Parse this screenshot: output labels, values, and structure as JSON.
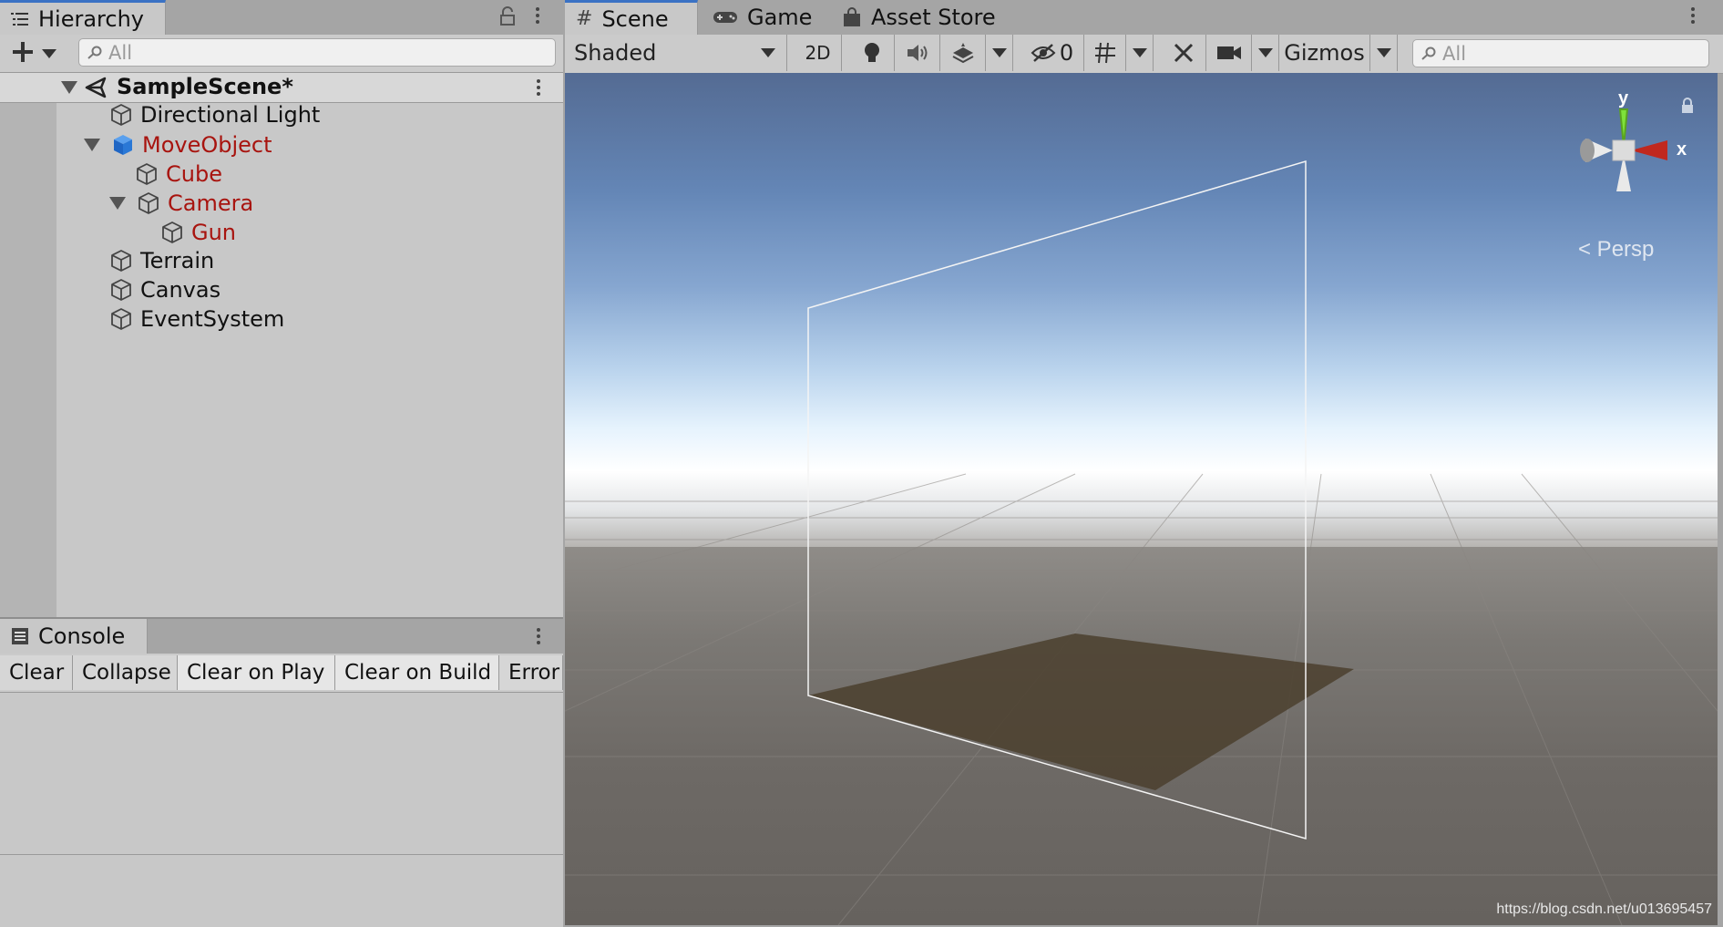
{
  "hierarchy": {
    "tab_label": "Hierarchy",
    "search_placeholder": "All",
    "scene_name": "SampleScene*",
    "items": [
      {
        "label": "Directional Light"
      },
      {
        "label": "MoveObject"
      },
      {
        "label": "Cube"
      },
      {
        "label": "Camera"
      },
      {
        "label": "Gun"
      },
      {
        "label": "Terrain"
      },
      {
        "label": "Canvas"
      },
      {
        "label": "EventSystem"
      }
    ]
  },
  "console": {
    "tab_label": "Console",
    "buttons": {
      "clear": "Clear",
      "collapse": "Collapse",
      "clear_on_play": "Clear on Play",
      "clear_on_build": "Clear on Build",
      "error_pause": "Error Pause"
    }
  },
  "scene_window": {
    "tabs": {
      "scene": "Scene",
      "game": "Game",
      "asset_store": "Asset Store"
    },
    "toolbar": {
      "shading_mode": "Shaded",
      "mode_2d": "2D",
      "hidden_count": "0",
      "gizmos": "Gizmos",
      "search_placeholder": "All"
    },
    "gizmo": {
      "y_label": "y",
      "x_label": "x",
      "projection": "< Persp"
    },
    "watermark": "https://blog.csdn.net/u013695457"
  },
  "colors": {
    "modified_object": "#a8140f",
    "active_tab_accent": "#3a72c4",
    "prefab_cube": "#2a78d6"
  }
}
